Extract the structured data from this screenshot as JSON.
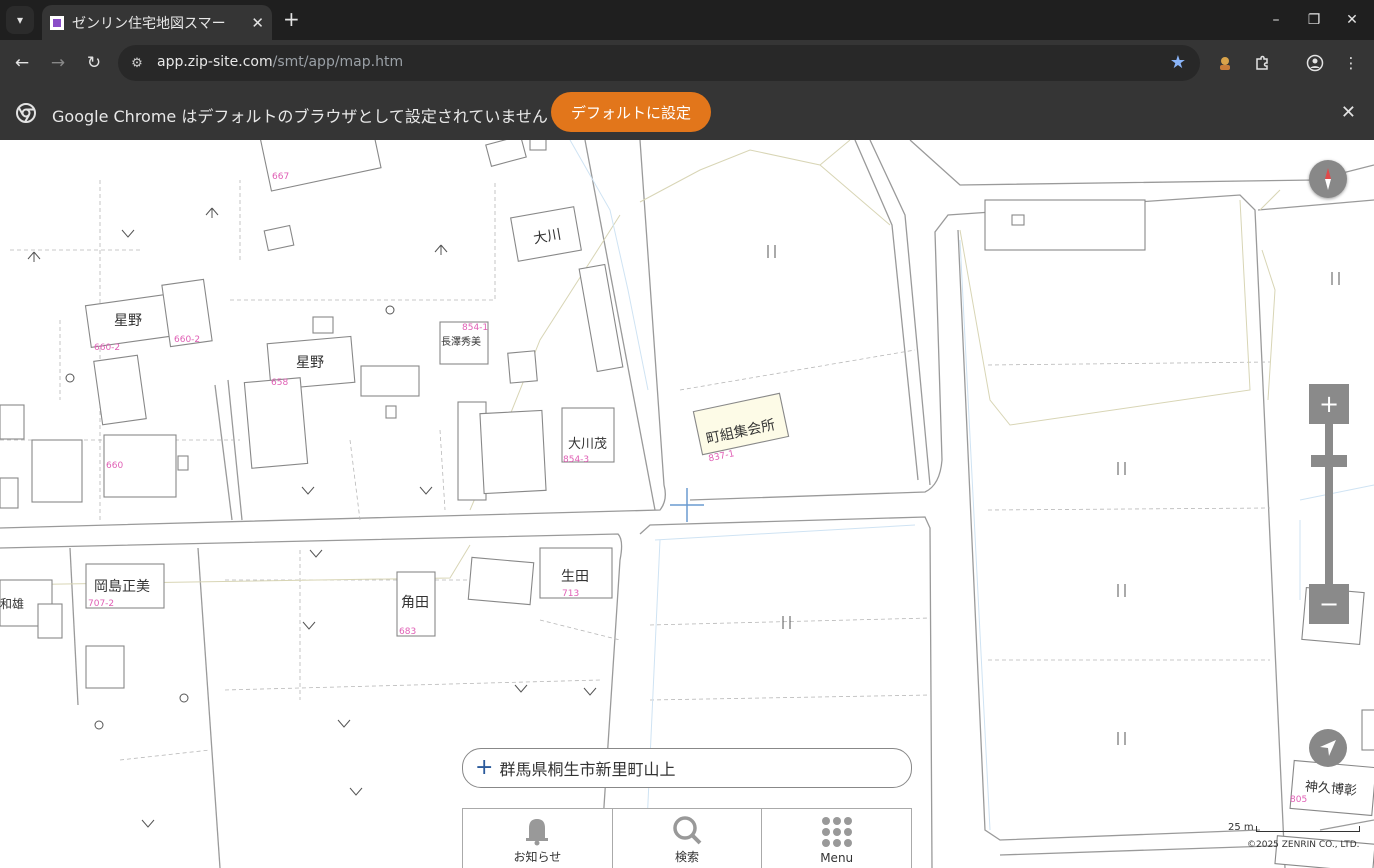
{
  "browser": {
    "tab_title": "ゼンリン住宅地図スマー",
    "url_host": "app.zip-site.com",
    "url_path": "/smt/app/map.htm",
    "infobar_text": "Google Chrome はデフォルトのブラウザとして設定されていません",
    "infobar_button": "デフォルトに設定"
  },
  "map": {
    "labels": {
      "ookawa": "大川",
      "hoshino1": "星野",
      "hoshino2": "星野",
      "nagasawa": "長澤秀美",
      "n854_1": "854-1",
      "ookawa_shigeru": "大川茂",
      "n854_3": "854-3",
      "machigumi": "町組集会所",
      "n837_1": "837-1",
      "okajima": "岡島正美",
      "n707_2": "707-2",
      "kakuta": "角田",
      "n683": "683",
      "ikuta": "生田",
      "n713": "713",
      "kazuo": "和雄",
      "kamiku": "神久博彰",
      "n805": "805",
      "n660_2a": "660-2",
      "n660_2b": "660-2",
      "n658": "658",
      "n667": "667",
      "n660": "660"
    },
    "address": "群馬県桐生市新里町山上",
    "scale": "25 m",
    "copyright": "©2025 ZENRIN CO., LTD."
  },
  "nav": {
    "notify": "お知らせ",
    "search": "検索",
    "menu": "Menu"
  },
  "icons": [
    "tab-list-icon",
    "close-icon",
    "plus-icon",
    "back-icon",
    "forward-icon",
    "reload-icon",
    "star-icon",
    "extension-icon",
    "profile-icon",
    "menu-dots-icon",
    "chrome-icon",
    "compass-icon",
    "zoom-in-icon",
    "zoom-out-icon",
    "locate-icon",
    "bell-icon",
    "search-icon",
    "grid-icon"
  ],
  "colors": {
    "accent": "#e2761b",
    "map_label_number": "#e05fb5",
    "control": "#8a8a8a"
  }
}
